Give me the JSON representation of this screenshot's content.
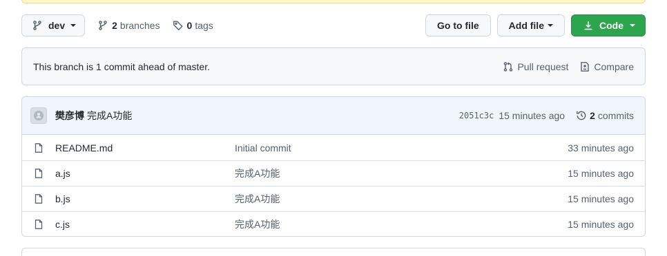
{
  "toolbar": {
    "branch_label": "dev",
    "branches_count": "2",
    "branches_label": "branches",
    "tags_count": "0",
    "tags_label": "tags",
    "go_to_file_label": "Go to file",
    "add_file_label": "Add file",
    "code_label": "Code"
  },
  "branch_info": {
    "message": "This branch is 1 commit ahead of master.",
    "pull_request_label": "Pull request",
    "compare_label": "Compare"
  },
  "latest_commit": {
    "author": "樊彦博",
    "message": "完成A功能",
    "hash": "2051c3c",
    "time": "15 minutes ago",
    "commits_count": "2",
    "commits_label": "commits"
  },
  "files": [
    {
      "name": "README.md",
      "message": "Initial commit",
      "date": "33 minutes ago",
      "icon": "file-icon"
    },
    {
      "name": "a.js",
      "message": "完成A功能",
      "date": "15 minutes ago",
      "icon": "file-icon"
    },
    {
      "name": "b.js",
      "message": "完成A功能",
      "date": "15 minutes ago",
      "icon": "file-icon"
    },
    {
      "name": "c.js",
      "message": "完成A功能",
      "date": "15 minutes ago",
      "icon": "file-icon"
    }
  ],
  "colors": {
    "code_button": "#2da44e",
    "commit_header_bg": "#f0f6fc",
    "banner_bg": "#fff8c5"
  }
}
